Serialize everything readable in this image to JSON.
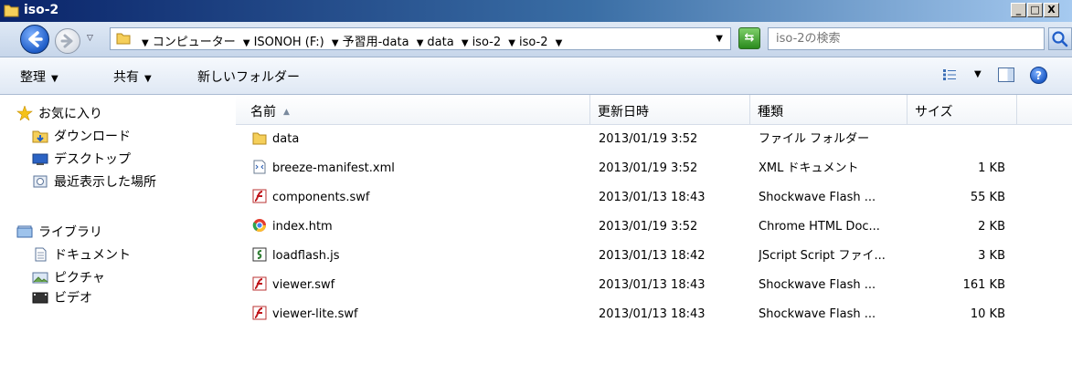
{
  "window": {
    "title": "iso-2"
  },
  "title_buttons": [
    "_",
    "□",
    "X"
  ],
  "address": {
    "breadcrumbs": [
      "コンピューター",
      "ISONOH (F:)",
      "予習用-data",
      "data",
      "iso-2",
      "iso-2"
    ]
  },
  "search": {
    "placeholder": "iso-2の検索"
  },
  "toolbar": {
    "organize": "整理",
    "share": "共有",
    "new_folder": "新しいフォルダー"
  },
  "nav": {
    "favorites": "お気に入り",
    "downloads": "ダウンロード",
    "desktop": "デスクトップ",
    "recent": "最近表示した場所",
    "libraries": "ライブラリ",
    "documents": "ドキュメント",
    "pictures": "ピクチャ",
    "videos": "ビデオ"
  },
  "columns": {
    "name": "名前",
    "date": "更新日時",
    "type": "種類",
    "size": "サイズ"
  },
  "files": [
    {
      "name": "data",
      "date": "2013/01/19 3:52",
      "type": "ファイル フォルダー",
      "size": "",
      "icon": "folder-icon"
    },
    {
      "name": "breeze-manifest.xml",
      "date": "2013/01/19 3:52",
      "type": "XML ドキュメント",
      "size": "1 KB",
      "icon": "xml-file-icon"
    },
    {
      "name": "components.swf",
      "date": "2013/01/13 18:43",
      "type": "Shockwave Flash ...",
      "size": "55 KB",
      "icon": "flash-file-icon"
    },
    {
      "name": "index.htm",
      "date": "2013/01/19 3:52",
      "type": "Chrome HTML Doc...",
      "size": "2 KB",
      "icon": "chrome-html-icon"
    },
    {
      "name": "loadflash.js",
      "date": "2013/01/13 18:42",
      "type": "JScript Script ファイ...",
      "size": "3 KB",
      "icon": "jscript-file-icon"
    },
    {
      "name": "viewer.swf",
      "date": "2013/01/13 18:43",
      "type": "Shockwave Flash ...",
      "size": "161 KB",
      "icon": "flash-file-icon"
    },
    {
      "name": "viewer-lite.swf",
      "date": "2013/01/13 18:43",
      "type": "Shockwave Flash ...",
      "size": "10 KB",
      "icon": "flash-file-icon"
    }
  ]
}
